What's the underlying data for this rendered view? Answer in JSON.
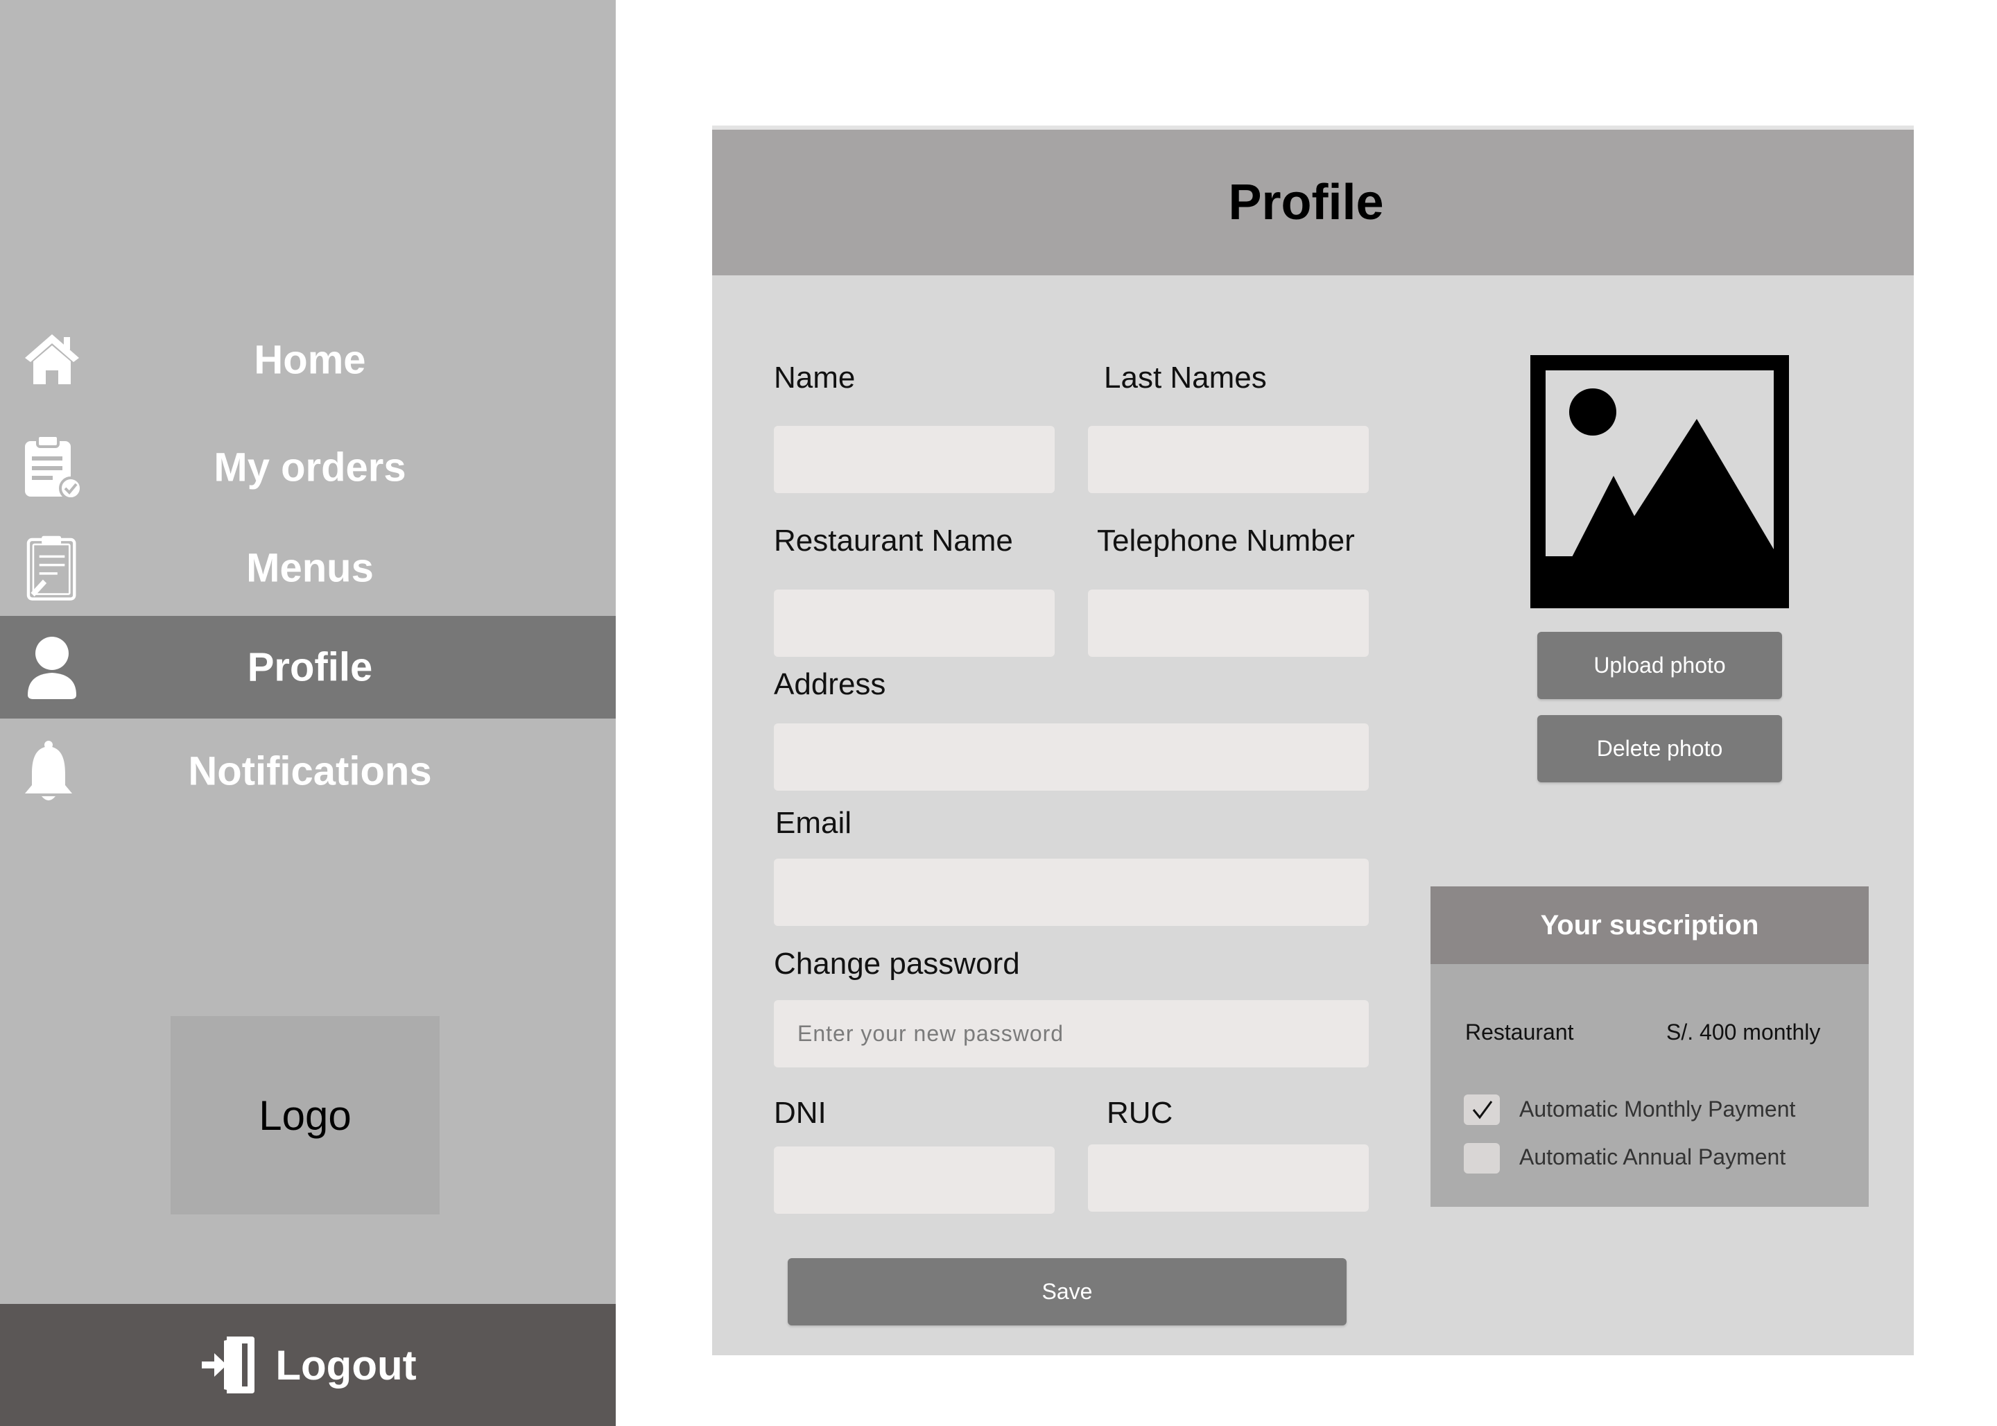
{
  "sidebar": {
    "items": [
      {
        "label": "Home",
        "icon": "home-icon"
      },
      {
        "label": "My orders",
        "icon": "clipboard-check-icon"
      },
      {
        "label": "Menus",
        "icon": "notepad-icon"
      },
      {
        "label": "Profile",
        "icon": "user-icon",
        "active": true
      },
      {
        "label": "Notifications",
        "icon": "bell-icon"
      }
    ],
    "logo_text": "Logo",
    "logout_label": "Logout",
    "logout_icon": "logout-icon"
  },
  "profile": {
    "title": "Profile",
    "fields": {
      "name_label": "Name",
      "last_names_label": "Last Names",
      "restaurant_name_label": "Restaurant Name",
      "telephone_label": "Telephone Number",
      "address_label": "Address",
      "email_label": "Email",
      "change_password_label": "Change password",
      "password_placeholder": "Enter your new password",
      "dni_label": "DNI",
      "ruc_label": "RUC"
    },
    "save_label": "Save",
    "photo": {
      "icon": "image-placeholder-icon",
      "upload_label": "Upload photo",
      "delete_label": "Delete photo"
    }
  },
  "subscription": {
    "title": "Your suscription",
    "plan_name": "Restaurant",
    "plan_price": "S/. 400 monthly",
    "options": [
      {
        "label": "Automatic Monthly Payment",
        "checked": true
      },
      {
        "label": "Automatic Annual Payment",
        "checked": false
      }
    ]
  },
  "colors": {
    "sidebar_bg": "#b8b8b8",
    "active_item_bg": "#777777",
    "logout_bg": "#5b5756",
    "card_bg": "#d8d8d8",
    "card_header_bg": "#a6a4a4",
    "input_bg": "#ebe8e7",
    "button_bg": "#7a7a7a"
  }
}
